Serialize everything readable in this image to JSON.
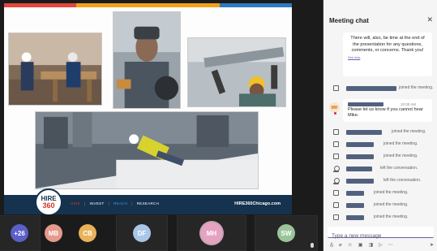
{
  "colors": {
    "slide_top_stripes": [
      "#e2483b",
      "#f4a11a",
      "#f4a11a",
      "#2c7cc0"
    ],
    "footer_bg": "#15324f",
    "accent": "#6264a7",
    "redacted_name": "#52627e"
  },
  "slide": {
    "logo": {
      "line1": "HIRE",
      "line2": "360"
    },
    "footer_links": [
      "HIRE",
      "|",
      "INVEST",
      "|",
      "REACH",
      "|",
      "RESEARCH"
    ],
    "footer_url": "HIRE360Chicago.com"
  },
  "participants": [
    {
      "initials": "+26",
      "color": "#5b5fc7"
    },
    {
      "initials": "MB",
      "color": "#e59a8c"
    },
    {
      "initials": "CB",
      "color": "#e9b25a"
    },
    {
      "initials": "DF",
      "color": "#a9c5e8"
    },
    {
      "initials": "MH",
      "color": "#e6a2c0"
    },
    {
      "initials": "SW",
      "color": "#9ac59b"
    }
  ],
  "chat": {
    "title": "Meeting chat",
    "close_icon": "close-icon",
    "first_message": "There will, also, be time at the end of the presentation for any questions, comments, or concerns. Thank you!",
    "see_more": "See less",
    "events": [
      {
        "text": "joined the meeting.",
        "icon": "person-join-icon"
      },
      {
        "text": "joined the meeting.",
        "icon": "person-join-icon"
      },
      {
        "text": "joined the meeting.",
        "icon": "person-join-icon"
      },
      {
        "text": "left the conversation.",
        "icon": "person-leave-icon"
      },
      {
        "text": "left the conversation.",
        "icon": "person-leave-icon"
      },
      {
        "text": "joined the meeting.",
        "icon": "person-join-icon"
      },
      {
        "text": "joined the meeting.",
        "icon": "person-join-icon"
      },
      {
        "text": "joined the meeting.",
        "icon": "person-join-icon"
      }
    ],
    "first_event": {
      "text": "joined the meeting."
    },
    "message2": {
      "avatar": "MH",
      "time": "10:00 AM",
      "text": "Please let us know if you cannot hear Mike."
    },
    "compose_placeholder": "Type a new message",
    "toolbar_icons": [
      "format-icon",
      "attach-icon",
      "emoji-icon",
      "gif-icon",
      "sticker-icon",
      "share-icon",
      "more-icon",
      "send-icon"
    ]
  }
}
